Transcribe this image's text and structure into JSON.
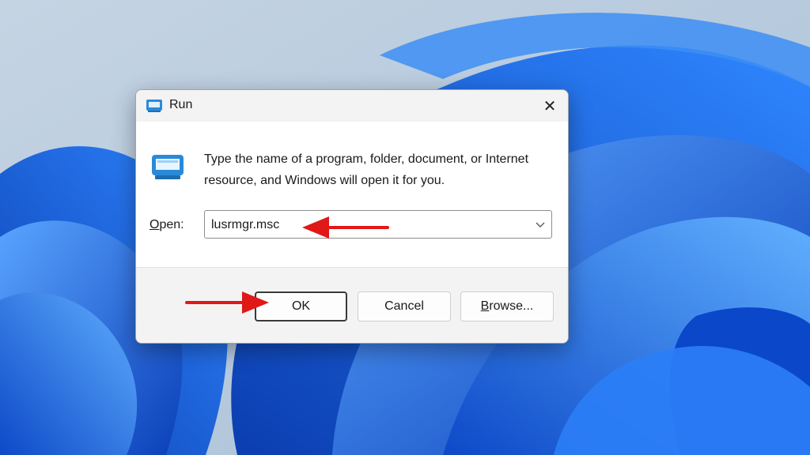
{
  "dialog": {
    "title": "Run",
    "close_glyph": "✕",
    "description": "Type the name of a program, folder, document, or Internet resource, and Windows will open it for you.",
    "open_label_underlined": "O",
    "open_label_rest": "pen:",
    "open_value": "lusrmgr.msc",
    "buttons": {
      "ok": "OK",
      "cancel": "Cancel",
      "browse_underlined": "B",
      "browse_rest": "rowse..."
    }
  },
  "icons": {
    "run_title": "run-icon",
    "run_large": "run-icon",
    "close": "close-icon",
    "combo_arrow": "chevron-down-icon"
  },
  "annotations": {
    "arrow_color": "#e01818",
    "targets": [
      "open-input",
      "ok-button"
    ]
  },
  "colors": {
    "wallpaper_blue": "#1a6ee8",
    "wallpaper_background": "#b7c9dc",
    "dialog_background": "#ffffff",
    "titlebar_background": "#f3f3f3"
  }
}
